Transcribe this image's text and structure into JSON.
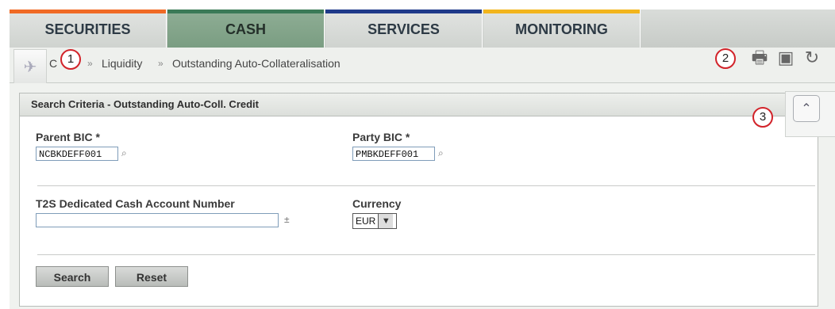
{
  "menu": {
    "tabs": [
      {
        "label": "SECURITIES",
        "stripe": "#f06a25"
      },
      {
        "label": "CASH",
        "stripe": "#3b7a57"
      },
      {
        "label": "SERVICES",
        "stripe": "#1f3a8a"
      },
      {
        "label": "MONITORING",
        "stripe": "#f2b51d"
      }
    ],
    "active_tab": "CASH"
  },
  "breadcrumb": {
    "items": [
      "C",
      "Liquidity",
      "Outstanding Auto-Collateralisation"
    ],
    "separator": "»"
  },
  "callouts": [
    "1",
    "2",
    "3"
  ],
  "toolbar": {
    "icons": [
      "print-icon",
      "save-icon",
      "refresh-icon"
    ]
  },
  "panel": {
    "title": "Search Criteria - Outstanding Auto-Coll. Credit",
    "fields": {
      "parent_bic_label": "Parent BIC  *",
      "parent_bic_value": "NCBKDEFF001",
      "party_bic_label": "Party BIC  *",
      "party_bic_value": "PMBKDEFF001",
      "account_label": "T2S Dedicated Cash Account Number",
      "account_value": "",
      "currency_label": "Currency",
      "currency_value": "EUR"
    },
    "buttons": {
      "search": "Search",
      "reset": "Reset"
    }
  },
  "colors": {
    "active_tab": "#7a9d82",
    "callout_ring": "#d2232a"
  }
}
